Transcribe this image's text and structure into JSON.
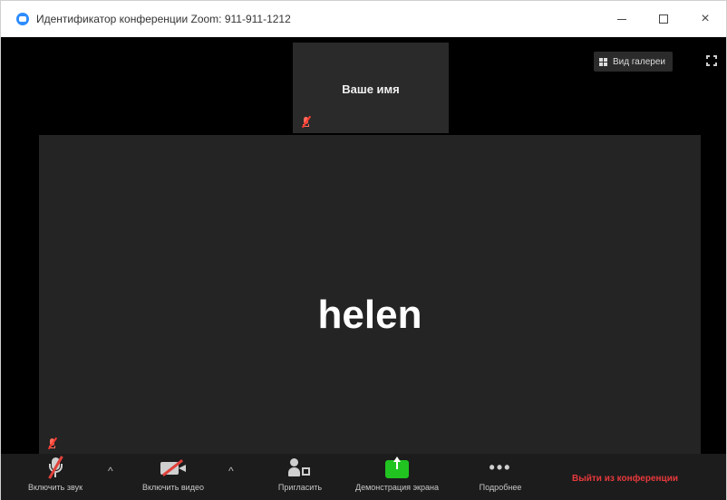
{
  "window": {
    "title": "Идентификатор конференции Zoom: 911-911-1212",
    "controls": {
      "minimize": "minimize",
      "maximize": "maximize",
      "close": "×"
    }
  },
  "stage": {
    "self_tile_name": "Ваше имя",
    "main_tile_name": "helen",
    "view_button_label": "Вид галереи"
  },
  "toolbar": {
    "audio_label": "Включить звук",
    "video_label": "Включить видео",
    "invite_label": "Пригласить",
    "share_label": "Демонстрация экрана",
    "more_label": "Подробнее",
    "more_glyph": "•••",
    "caret": "^",
    "leave_label": "Выйти из конференции"
  },
  "colors": {
    "accent_blue": "#2d8cff",
    "share_green": "#21c321",
    "leave_red": "#e8393c",
    "muted_red": "#ff3b30",
    "tile_bg": "#242424",
    "toolbar_bg": "#1c1c1c"
  }
}
